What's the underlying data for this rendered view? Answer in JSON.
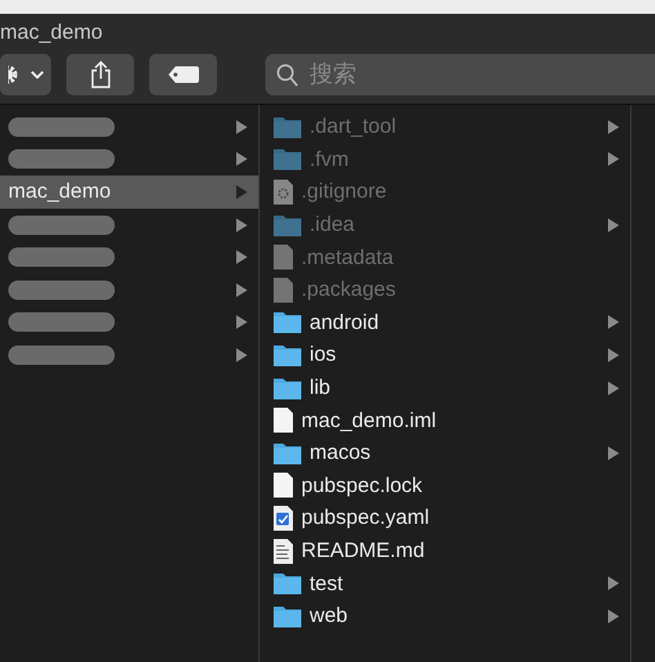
{
  "window": {
    "title": "mac_demo"
  },
  "toolbar": {
    "search": {
      "placeholder": "搜索"
    }
  },
  "parent_column": [
    {
      "kind": "redacted",
      "selected": false
    },
    {
      "kind": "redacted",
      "selected": false
    },
    {
      "kind": "folder",
      "name": "mac_demo",
      "selected": true
    },
    {
      "kind": "redacted",
      "selected": false
    },
    {
      "kind": "redacted",
      "selected": false
    },
    {
      "kind": "redacted",
      "selected": false
    },
    {
      "kind": "redacted",
      "selected": false
    },
    {
      "kind": "redacted",
      "selected": false
    }
  ],
  "files": [
    {
      "name": ".dart_tool",
      "kind": "folder",
      "hidden": true
    },
    {
      "name": ".fvm",
      "kind": "folder",
      "hidden": true
    },
    {
      "name": ".gitignore",
      "kind": "config",
      "hidden": true
    },
    {
      "name": ".idea",
      "kind": "folder",
      "hidden": true
    },
    {
      "name": ".metadata",
      "kind": "file",
      "hidden": true
    },
    {
      "name": ".packages",
      "kind": "file",
      "hidden": true
    },
    {
      "name": "android",
      "kind": "folder",
      "hidden": false
    },
    {
      "name": "ios",
      "kind": "folder",
      "hidden": false
    },
    {
      "name": "lib",
      "kind": "folder",
      "hidden": false
    },
    {
      "name": "mac_demo.iml",
      "kind": "file",
      "hidden": false
    },
    {
      "name": "macos",
      "kind": "folder",
      "hidden": false
    },
    {
      "name": "pubspec.lock",
      "kind": "file",
      "hidden": false
    },
    {
      "name": "pubspec.yaml",
      "kind": "yaml",
      "hidden": false
    },
    {
      "name": "README.md",
      "kind": "text",
      "hidden": false
    },
    {
      "name": "test",
      "kind": "folder",
      "hidden": false
    },
    {
      "name": "web",
      "kind": "folder",
      "hidden": false
    }
  ]
}
